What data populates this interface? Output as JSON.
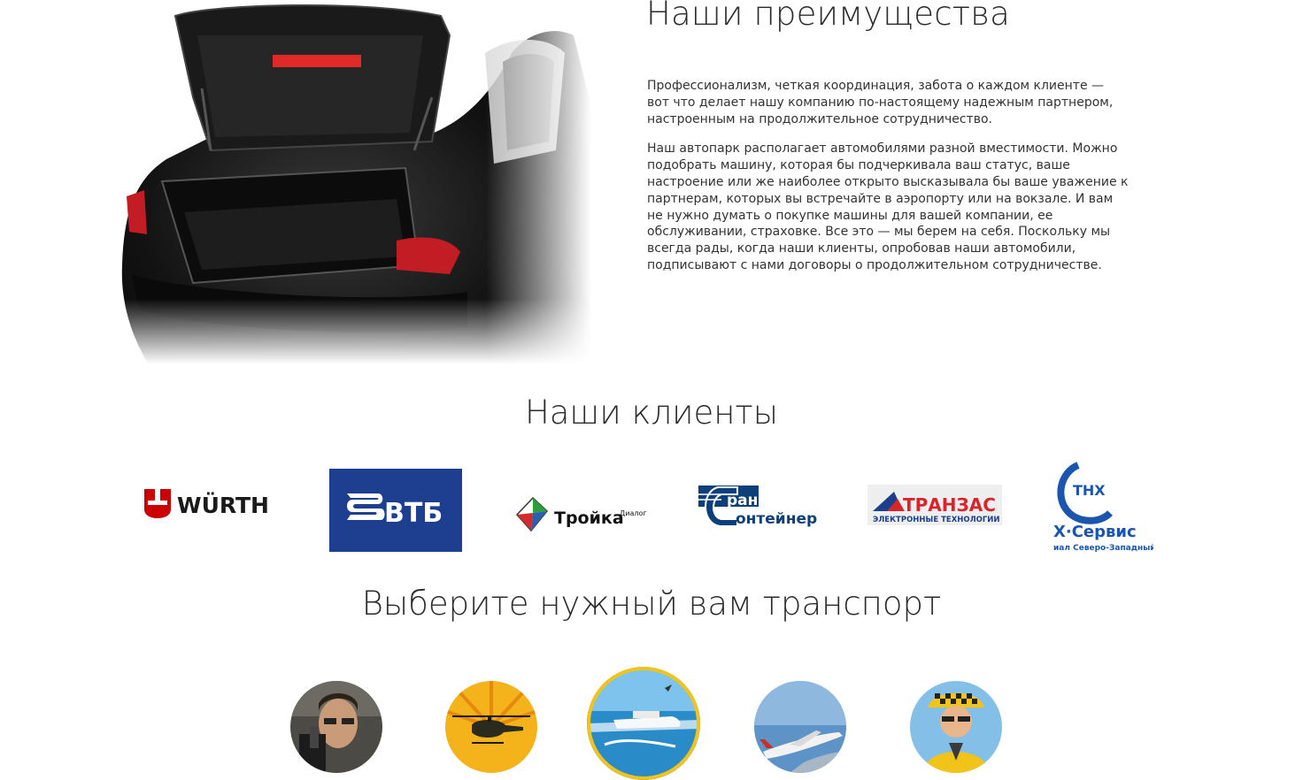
{
  "advantages": {
    "title": "Наши преимущества",
    "paragraph_1": "Профессионализм, четкая координация, забота о каждом клиенте — вот что делает нашу компанию по-настоящему надежным партнером, настроенным на продолжительное сотрудничество.",
    "paragraph_2": "Наш автопарк располагает автомобилями разной вместимости. Можно подобрать машину, которая бы подчеркивала ваш статус, ваше настроение или же наиболее открыто высказывала бы ваше уважение к партнерам, которых вы встречайте в аэропорту или на вокзале. И вам не нужно думать о покупке машины для вашей компании, ее обслуживании, страховке. Все это — мы берем на себя. Поскольку мы всегда рады, когда наши клиенты, опробовав наши автомобили, подписывают с нами договоры о продолжительном сотрудничестве."
  },
  "clients": {
    "title": "Наши клиенты",
    "logos": [
      {
        "name": "WÜRTH",
        "text": "WÜRTH",
        "color": "#cc0000"
      },
      {
        "name": "ВТБ",
        "text": "ВТБ",
        "color": "#1e3f8f"
      },
      {
        "name": "Тройка Диалог",
        "text": "Тройка",
        "superscript": "Диалог",
        "color": "#111111"
      },
      {
        "name": "Транс Контейнер",
        "line_1": "ранс",
        "line_2": "онтейнер",
        "color": "#0d3f7a"
      },
      {
        "name": "Транзас",
        "text": "ТРАНЗАС",
        "subtitle": "ЭЛЕКТРОННЫЕ ТЕХНОЛОГИИ",
        "color": "#d6262b"
      },
      {
        "name": "ТНХ Сервис",
        "badge": "ТНХ",
        "text": "Х·Сервис",
        "subtitle": "иал Северо-Западный",
        "color": "#1a56b0"
      }
    ]
  },
  "transport": {
    "title": "Выберите нужный вам транспорт",
    "options": [
      {
        "icon": "driver-photo-icon",
        "selected": false
      },
      {
        "icon": "helicopter-icon",
        "selected": false
      },
      {
        "icon": "yacht-icon",
        "selected": true
      },
      {
        "icon": "business-jet-icon",
        "selected": false
      },
      {
        "icon": "taxi-driver-icon",
        "selected": false
      }
    ],
    "accent": "#f2c318"
  }
}
